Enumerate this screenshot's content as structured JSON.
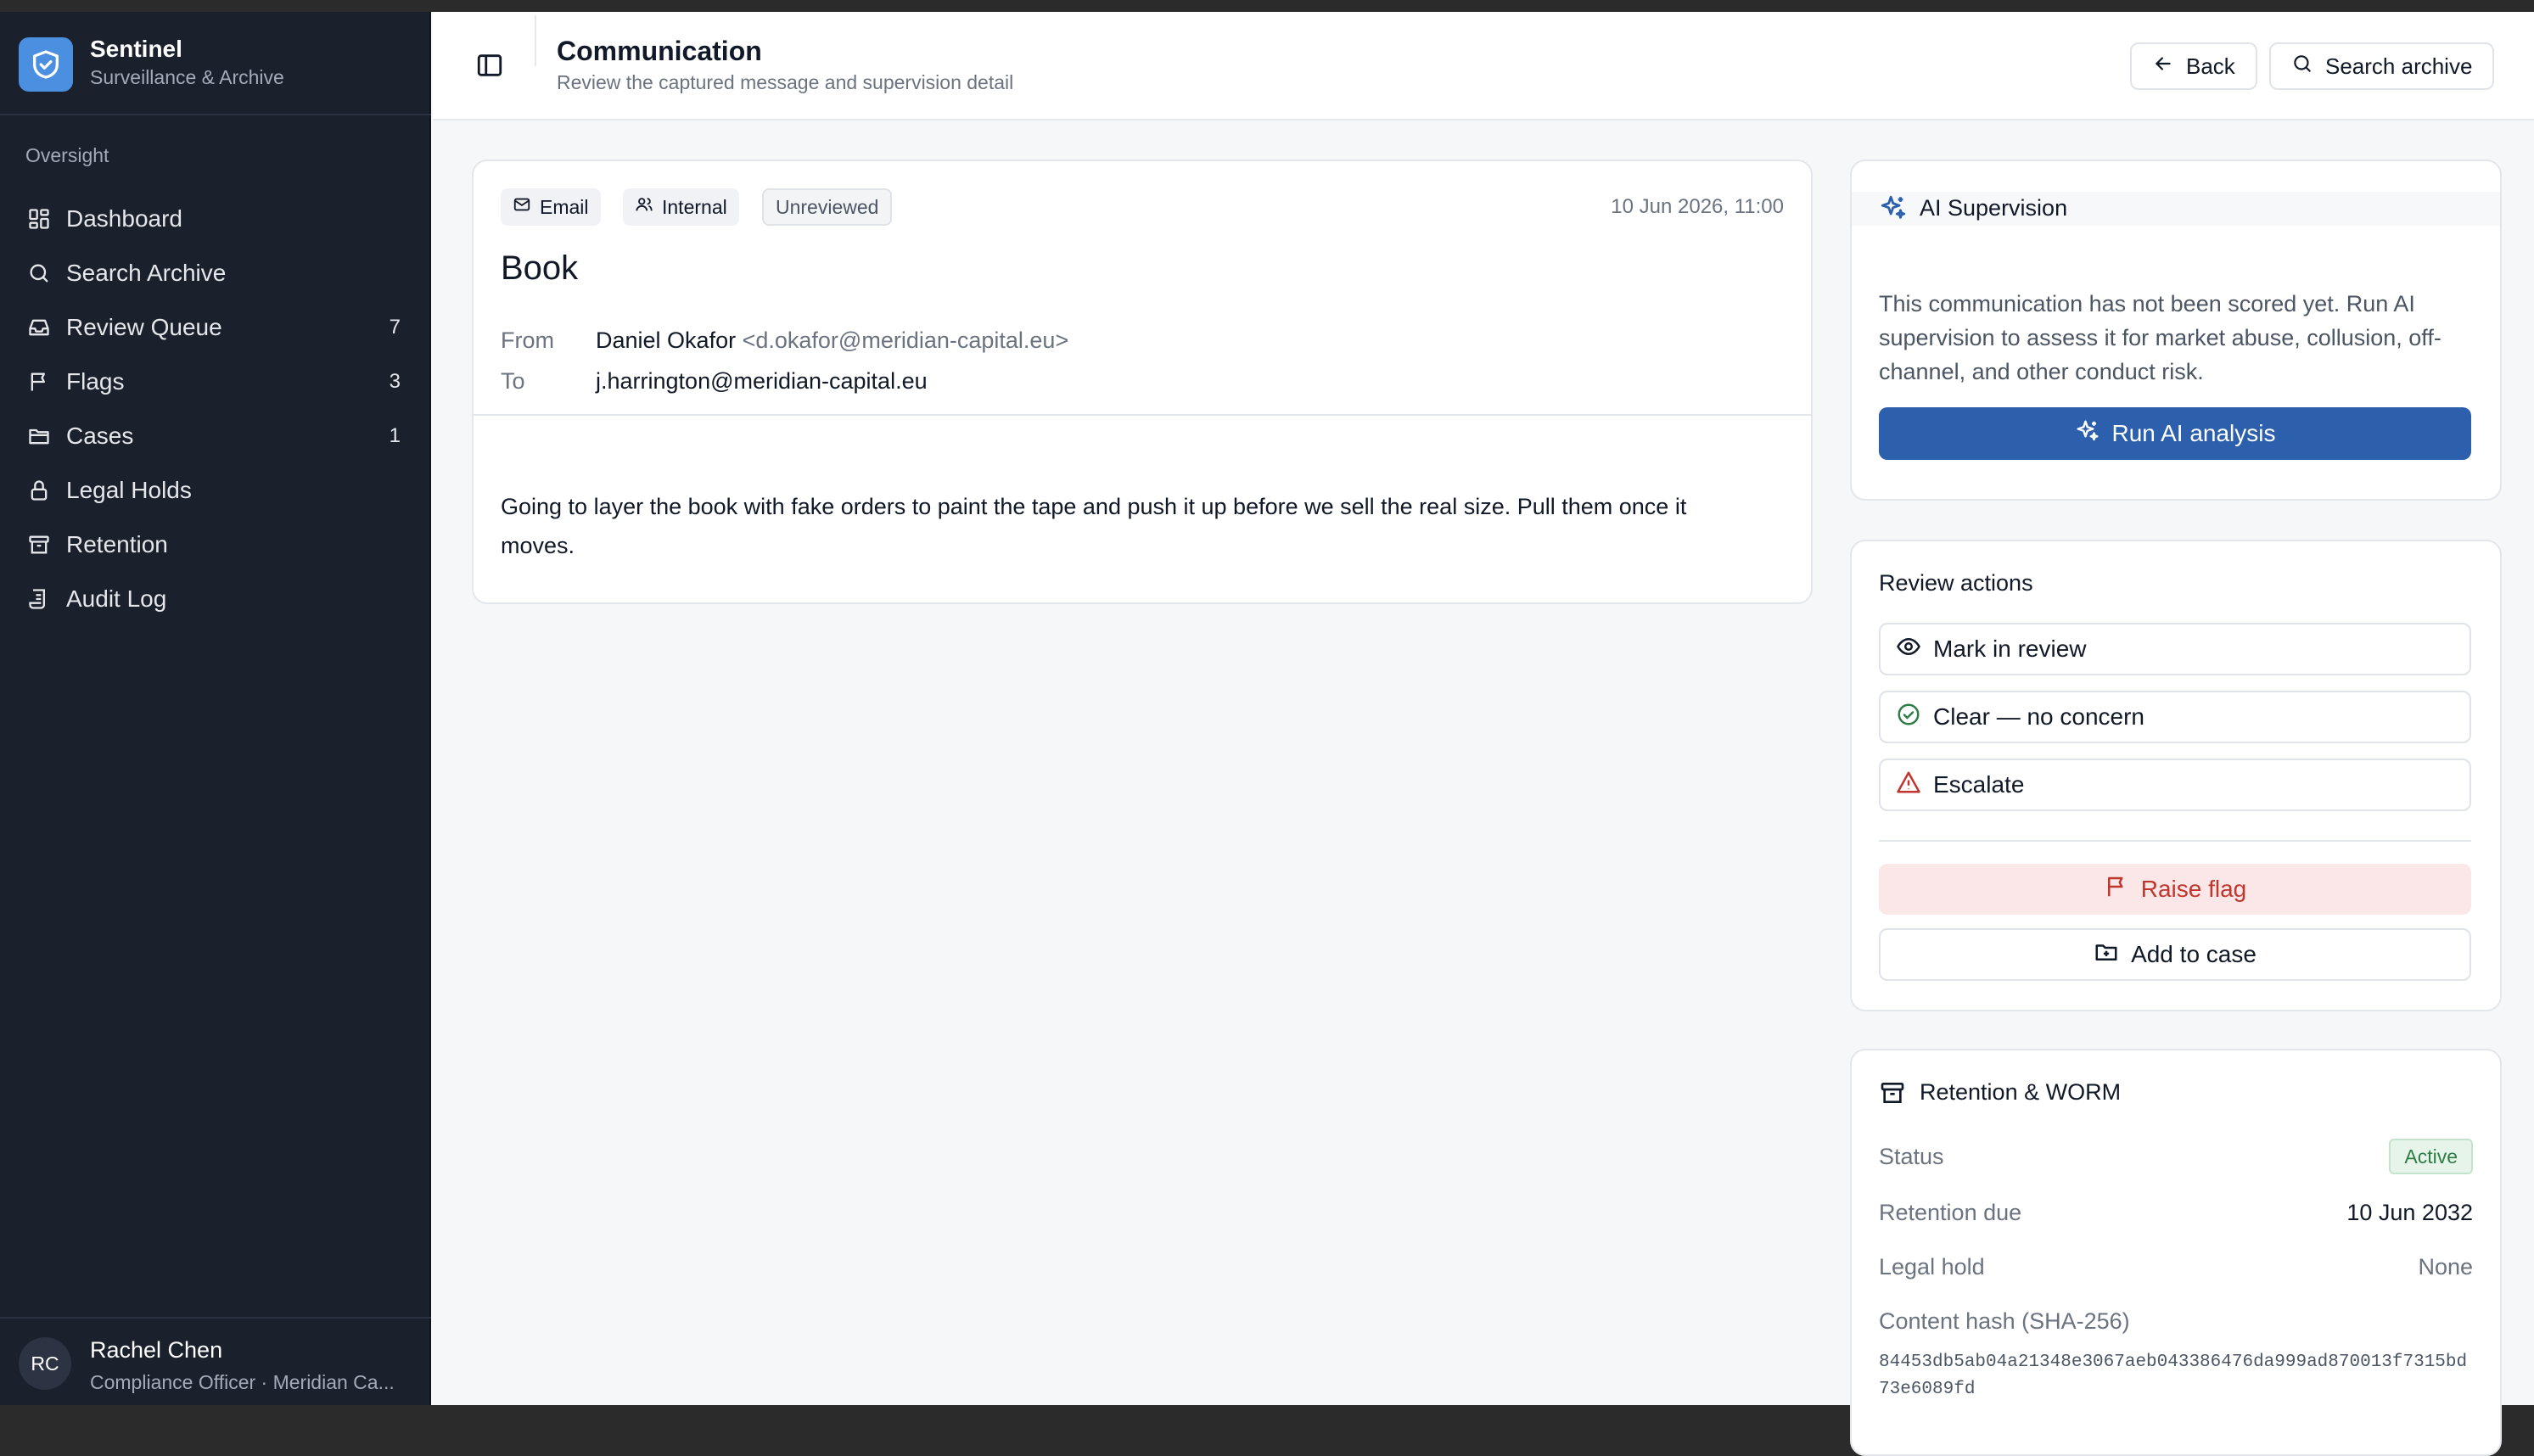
{
  "brand": {
    "title": "Sentinel",
    "subtitle": "Surveillance & Archive",
    "icon": "shield-icon",
    "color": "#4a8fe0"
  },
  "sidebar": {
    "section_label": "Oversight",
    "items": [
      {
        "label": "Dashboard",
        "icon": "dashboard-icon",
        "count": ""
      },
      {
        "label": "Search Archive",
        "icon": "search-icon",
        "count": ""
      },
      {
        "label": "Review Queue",
        "icon": "inbox-icon",
        "count": "7"
      },
      {
        "label": "Flags",
        "icon": "flag-icon",
        "count": "3"
      },
      {
        "label": "Cases",
        "icon": "folder-icon",
        "count": "1"
      },
      {
        "label": "Legal Holds",
        "icon": "lock-icon",
        "count": ""
      },
      {
        "label": "Retention",
        "icon": "archive-icon",
        "count": ""
      },
      {
        "label": "Audit Log",
        "icon": "audit-log-icon",
        "count": ""
      }
    ]
  },
  "user": {
    "initials": "RC",
    "name": "Rachel Chen",
    "role": "Compliance Officer · Meridian Ca..."
  },
  "header": {
    "title": "Communication",
    "subtitle": "Review the captured message and supervision detail",
    "back_label": "Back",
    "search_label": "Search archive"
  },
  "message": {
    "chips": {
      "channel": "Email",
      "scope": "Internal",
      "status": "Unreviewed"
    },
    "date": "10 Jun 2026, 11:00",
    "subject": "Book",
    "from_label": "From",
    "from_name": "Daniel Okafor",
    "from_email": "<d.okafor@meridian-capital.eu>",
    "to_label": "To",
    "to_value": "j.harrington@meridian-capital.eu",
    "body": "Going to layer the book with fake orders to paint the tape and push it up before we sell the real size. Pull them once it moves."
  },
  "ai": {
    "title": "AI Supervision",
    "text": "This communication has not been scored yet. Run AI supervision to assess it for market abuse, collusion, off-channel, and other conduct risk.",
    "button_label": "Run AI analysis",
    "accent": "#2c60ad"
  },
  "review": {
    "title": "Review actions",
    "mark_label": "Mark in review",
    "clear_label": "Clear — no concern",
    "escalate_label": "Escalate",
    "flag_label": "Raise flag",
    "case_label": "Add to case",
    "flag_color": "#c0362c"
  },
  "retention": {
    "title": "Retention & WORM",
    "status_label": "Status",
    "status_value": "Active",
    "due_label": "Retention due",
    "due_value": "10 Jun 2032",
    "hold_label": "Legal hold",
    "hold_value": "None",
    "hash_label": "Content hash (SHA-256)",
    "hash_value": "84453db5ab04a21348e3067aeb043386476da999ad870013f7315bd73e6089fd"
  }
}
